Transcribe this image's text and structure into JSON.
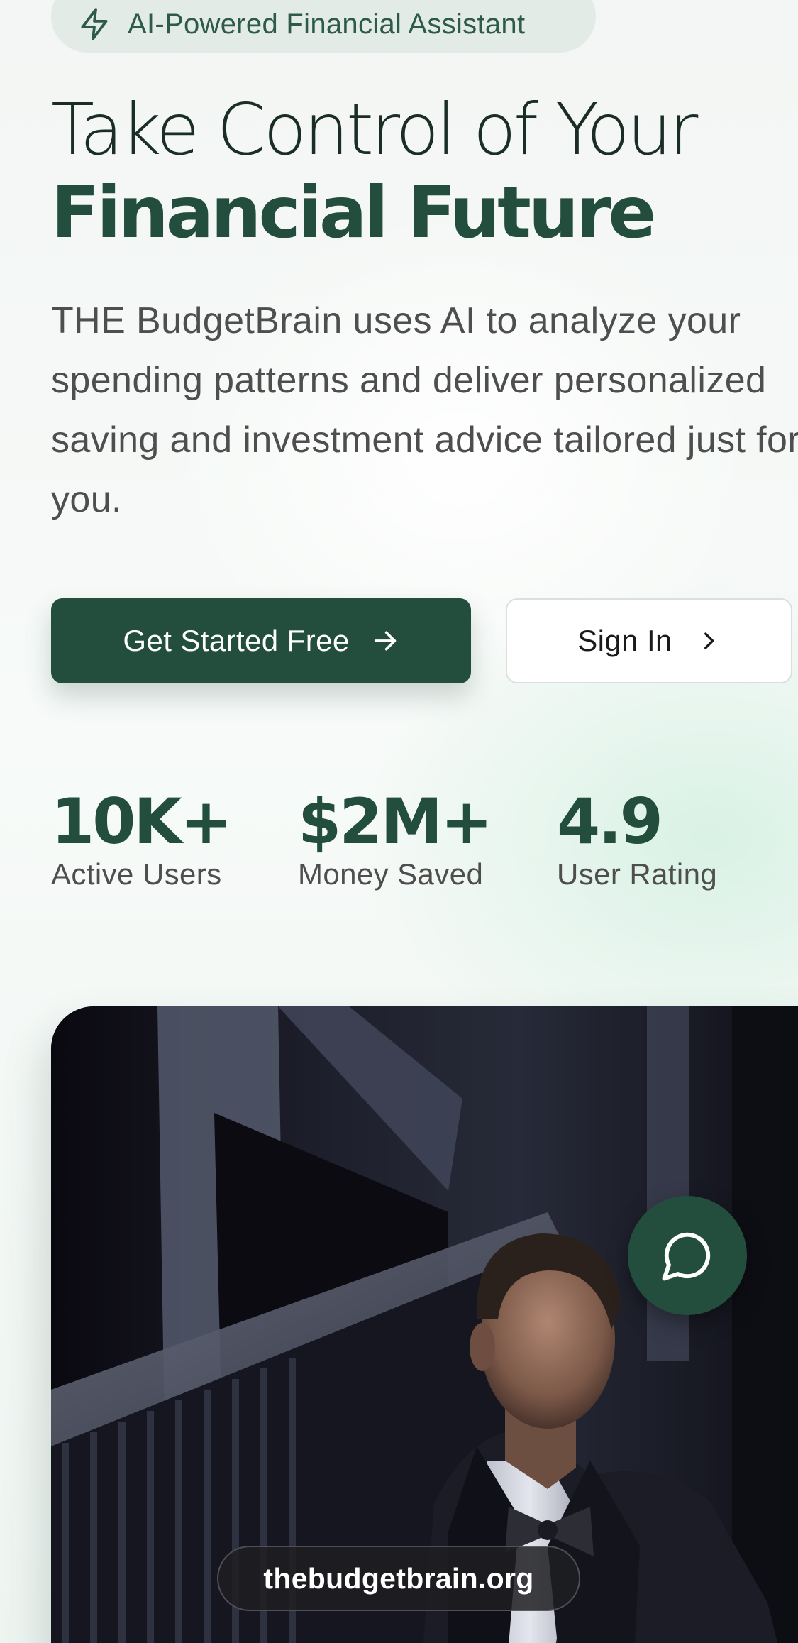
{
  "badge": {
    "icon": "lightning-bolt-icon",
    "label": "AI-Powered Financial Assistant"
  },
  "hero": {
    "headline_line1": "Take Control of Your",
    "headline_line2": "Financial Future",
    "description": "THE BudgetBrain uses AI to analyze your spending patterns and deliver personalized saving and investment advice tailored just for you."
  },
  "actions": {
    "primary_label": "Get Started Free",
    "primary_icon": "arrow-right-icon",
    "secondary_label": "Sign In",
    "secondary_icon": "chevron-right-icon"
  },
  "stats": [
    {
      "value": "10K+",
      "label": "Active Users"
    },
    {
      "value": "$2M+",
      "label": "Money Saved"
    },
    {
      "value": "4.9",
      "label": "User Rating"
    }
  ],
  "media": {
    "chat_icon": "chat-bubble-icon",
    "url_label": "thebudgetbrain.org"
  },
  "colors": {
    "brand_green": "#234e3e",
    "badge_bg": "#e3ebe7",
    "text_gray": "#4e4e4e"
  }
}
